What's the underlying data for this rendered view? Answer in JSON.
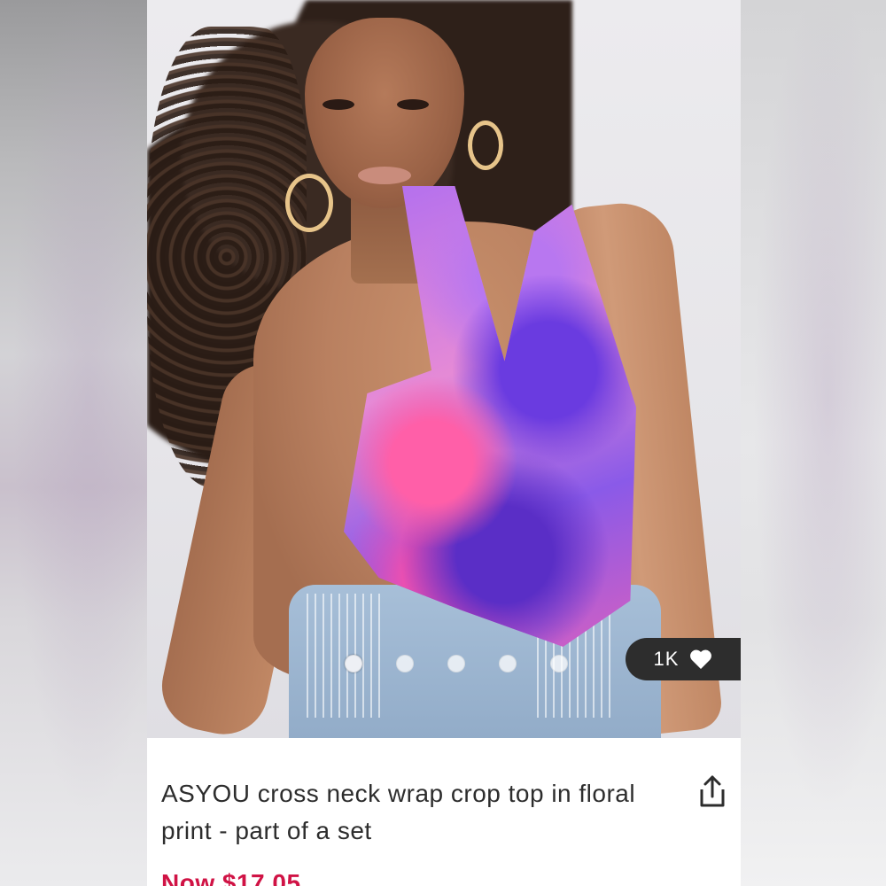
{
  "product": {
    "title": "ASYOU cross neck wrap crop top in floral print - part of a set",
    "price": "Now $17.05",
    "likes": "1K"
  },
  "carousel": {
    "count": 5,
    "active_index": 0
  },
  "icons": {
    "like": "heart-icon",
    "share": "share-icon"
  },
  "colors": {
    "price": "#d01345",
    "badge_bg": "#2d2d2d",
    "text": "#2d2d2d"
  }
}
